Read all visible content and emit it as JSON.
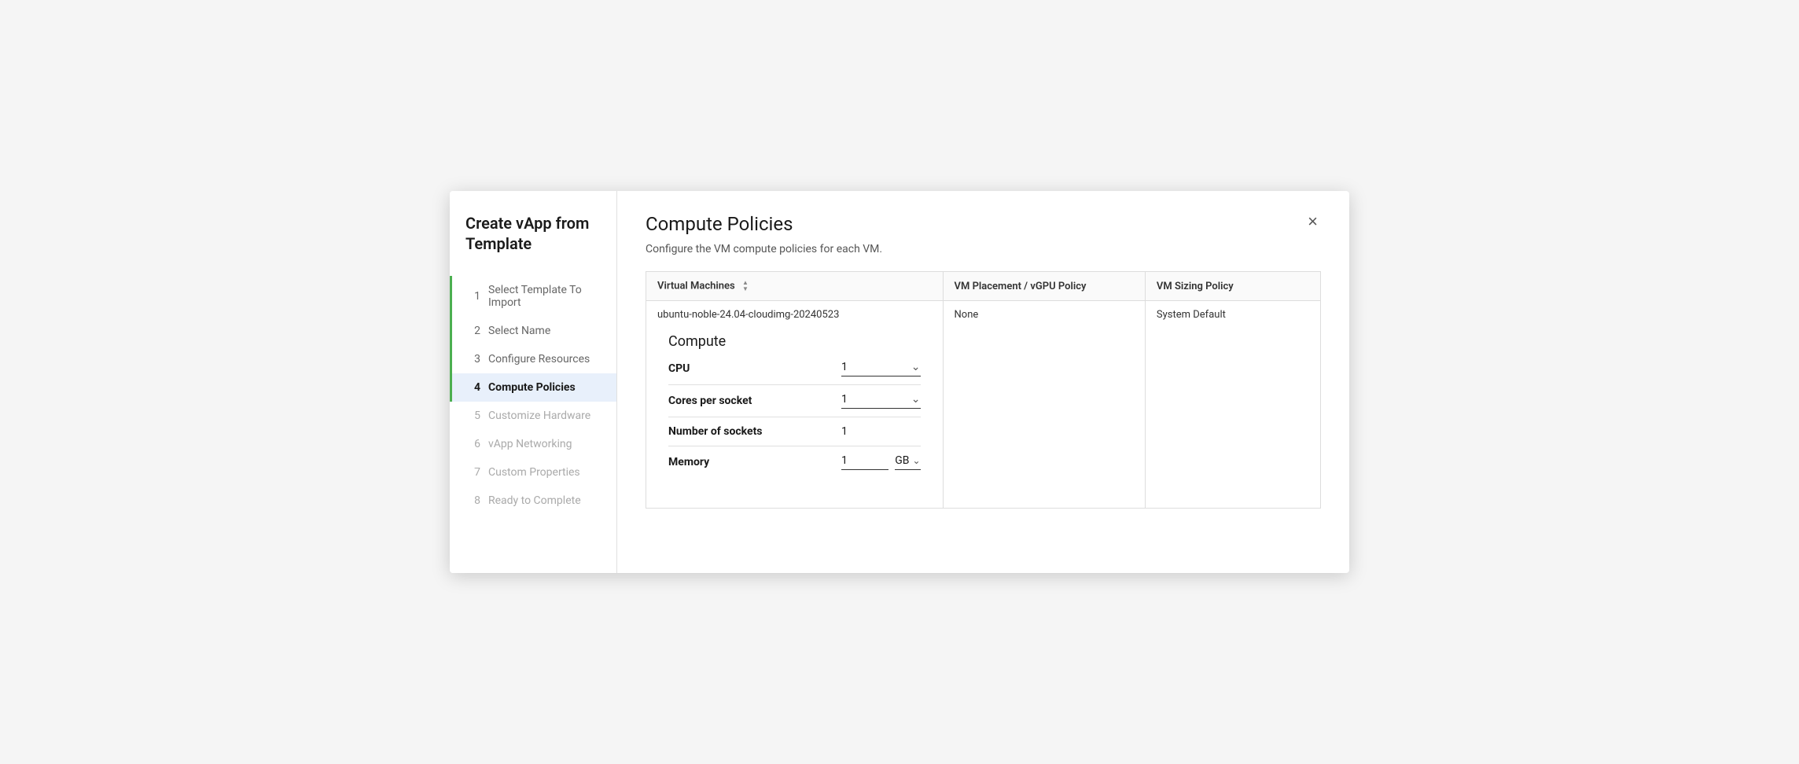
{
  "modal": {
    "title": "Create vApp from Template",
    "close_label": "×",
    "subtitle": "Configure the VM compute policies for each VM."
  },
  "sidebar": {
    "items": [
      {
        "num": "1",
        "label": "Select Template To Import",
        "state": "completed"
      },
      {
        "num": "2",
        "label": "Select Name",
        "state": "completed"
      },
      {
        "num": "3",
        "label": "Configure Resources",
        "state": "completed"
      },
      {
        "num": "4",
        "label": "Compute Policies",
        "state": "active"
      },
      {
        "num": "5",
        "label": "Customize Hardware",
        "state": "disabled"
      },
      {
        "num": "6",
        "label": "vApp Networking",
        "state": "disabled"
      },
      {
        "num": "7",
        "label": "Custom Properties",
        "state": "disabled"
      },
      {
        "num": "8",
        "label": "Ready to Complete",
        "state": "disabled"
      }
    ]
  },
  "main": {
    "title": "Compute Policies",
    "table": {
      "headers": [
        {
          "key": "vm",
          "label": "Virtual Machines",
          "sortable": true
        },
        {
          "key": "placement",
          "label": "VM Placement / vGPU Policy",
          "sortable": false
        },
        {
          "key": "sizing",
          "label": "VM Sizing Policy",
          "sortable": false
        }
      ],
      "rows": [
        {
          "vm": "ubuntu-noble-24.04-cloudimg-20240523",
          "placement": "None",
          "sizing": "System Default"
        }
      ]
    },
    "compute": {
      "section_title": "Compute",
      "fields": [
        {
          "label": "CPU",
          "value": "1",
          "type": "select"
        },
        {
          "label": "Cores per socket",
          "value": "1",
          "type": "select"
        },
        {
          "label": "Number of sockets",
          "value": "1",
          "type": "text"
        },
        {
          "label": "Memory",
          "value": "1",
          "type": "memory",
          "unit": "GB"
        }
      ]
    }
  }
}
